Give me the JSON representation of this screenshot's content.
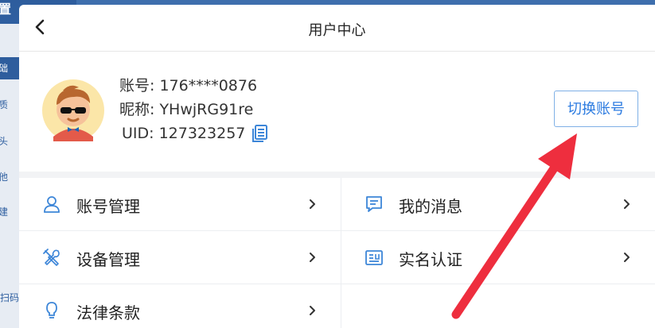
{
  "background": {
    "side_title": "置",
    "side_items": [
      "础",
      "质",
      "头",
      "他",
      "建"
    ],
    "side_scan": "扫码"
  },
  "header": {
    "title": "用户中心"
  },
  "profile": {
    "account_label": "账号: 176****0876",
    "nickname_label": "昵称: YHwjRG91re",
    "uid_label": "UID: 127323257",
    "switch_button": "切换账号"
  },
  "menu": {
    "account_manage": "账号管理",
    "device_manage": "设备管理",
    "legal_terms": "法律条款",
    "my_messages": "我的消息",
    "real_name_auth": "实名认证"
  },
  "colors": {
    "accent": "#2c7be0",
    "icon_blue": "#3d86d8",
    "annotation_red": "#ee2e3e"
  }
}
